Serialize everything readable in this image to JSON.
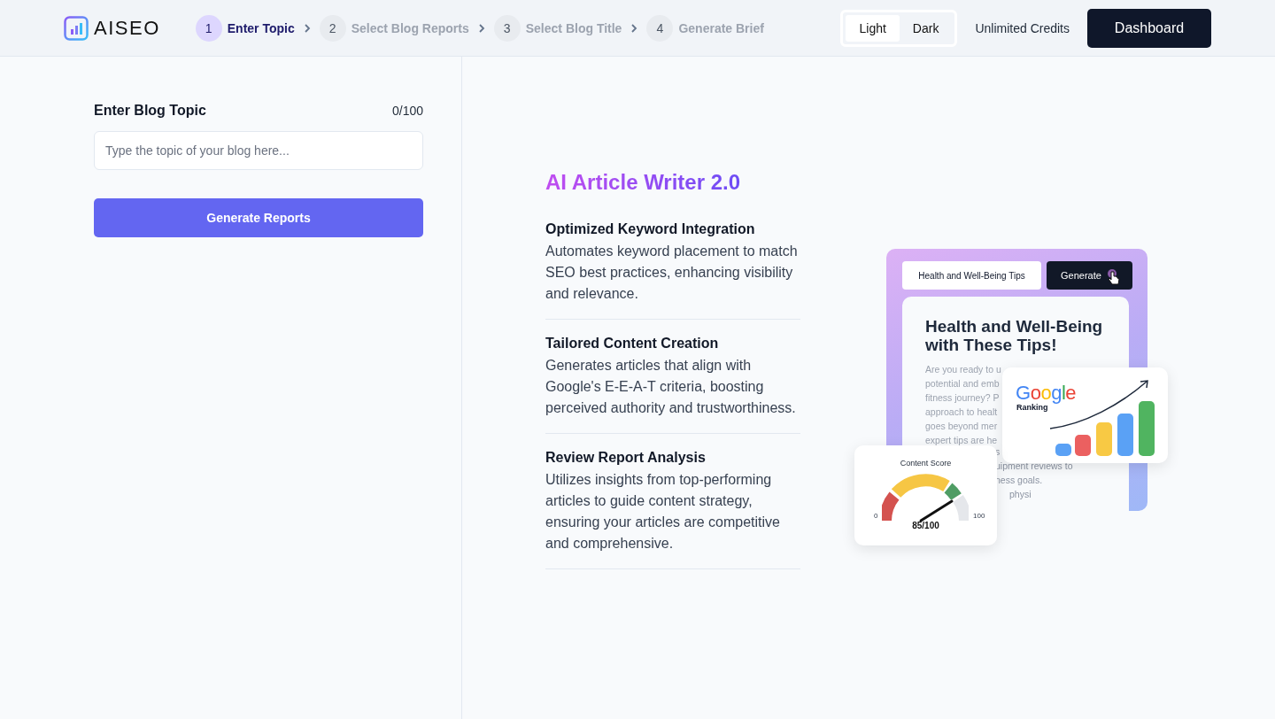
{
  "header": {
    "logo": "AISEO",
    "steps": [
      {
        "number": "1",
        "label": "Enter Topic",
        "selected": true
      },
      {
        "number": "2",
        "label": "Select Blog Reports",
        "selected": false
      },
      {
        "number": "3",
        "label": "Select Blog Title",
        "selected": false
      },
      {
        "number": "4",
        "label": "Generate Brief",
        "selected": false
      }
    ],
    "theme_options": [
      {
        "label": "Light",
        "selected": true
      },
      {
        "label": "Dark",
        "selected": false
      }
    ],
    "credits": "Unlimited Credits",
    "dashboard_button": "Dashboard"
  },
  "form": {
    "label": "Enter Blog Topic",
    "counter": "0/100",
    "placeholder": "Type the topic of your blog here...",
    "button": "Generate Reports"
  },
  "promo": {
    "title": "AI Article Writer 2.0",
    "features": [
      {
        "title": "Optimized Keyword Integration",
        "text": "Automates keyword placement to match SEO best practices, enhancing visibility and relevance."
      },
      {
        "title": "Tailored Content Creation",
        "text": "Generates articles that align with Google's E-E-A-T criteria, boosting perceived authority and trustworthiness."
      },
      {
        "title": "Review Report Analysis",
        "text": "Utilizes insights from top-performing articles to guide content strategy, ensuring your articles are competitive and comprehensive."
      }
    ]
  },
  "illustration": {
    "search_value": "Health and Well-Being Tips",
    "generate_button": "Generate",
    "article_title": "Health and Well-Being with These Tips!",
    "article_lines": [
      "Are you ready to u",
      "potential and emb",
      "fitness journey? P",
      "approach to healt",
      "goes beyond mer",
      "expert tips are he"
    ],
    "article_lines_after": [
      "s",
      "uipment reviews to",
      "ness goals.",
      "physi"
    ],
    "ranking_logo": "Google",
    "ranking_label": "Ranking",
    "score_title": "Content Score",
    "score_min": "0",
    "score_max": "100",
    "score": "85/100"
  }
}
